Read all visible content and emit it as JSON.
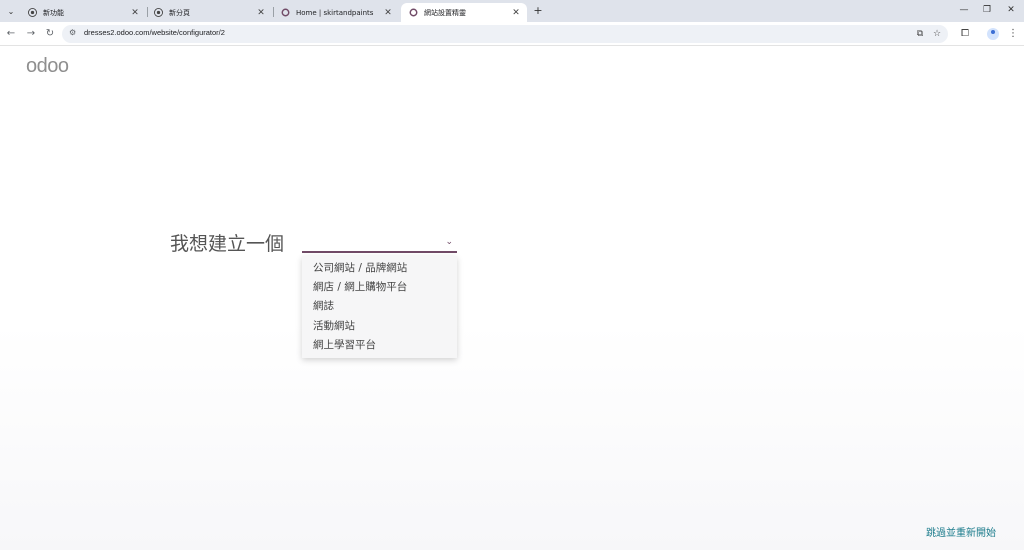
{
  "browser": {
    "tabs": [
      {
        "title": "新功能",
        "favicon": "chrome-icon",
        "active": false
      },
      {
        "title": "新分頁",
        "favicon": "chrome-icon",
        "active": false
      },
      {
        "title": "Home | skirtandpaints",
        "favicon": "odoo-icon",
        "active": false
      },
      {
        "title": "網站設置精靈",
        "favicon": "odoo-icon",
        "active": true
      }
    ],
    "new_tab_label": "+",
    "url": "dresses2.odoo.com/website/configurator/2"
  },
  "page": {
    "logo": "odoo",
    "question": "我想建立一個",
    "dropdown_items": [
      "公司網站 / 品牌網站",
      "網店 / 網上購物平台",
      "網誌",
      "活動網站",
      "網上學習平台"
    ],
    "skip_link": "跳過並重新開始"
  },
  "colors": {
    "brand": "#714b67",
    "link": "#1c7c8c",
    "tabstrip": "#dfe3eb"
  }
}
